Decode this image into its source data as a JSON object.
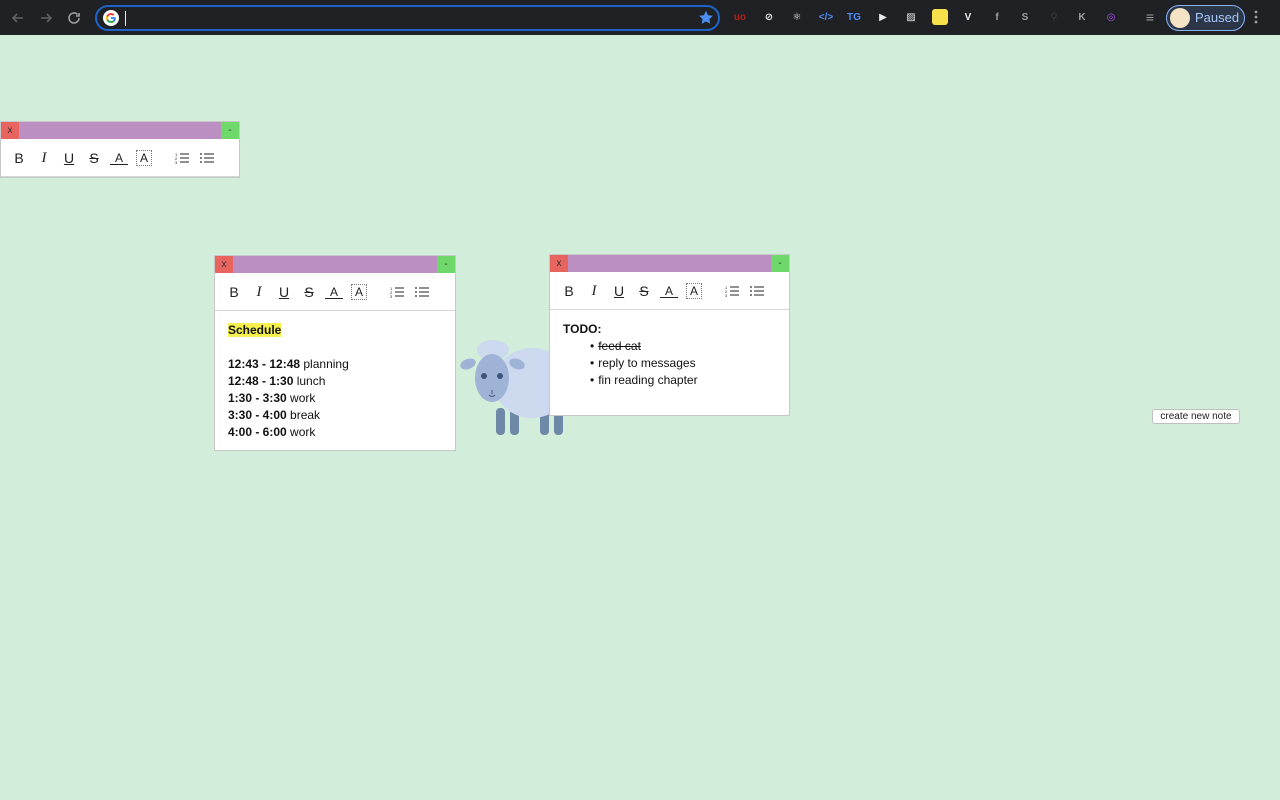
{
  "browser": {
    "omnibox_value": "",
    "profile_label": "Paused",
    "extensions": [
      {
        "name": "ublock-icon",
        "glyph": "uo",
        "color": "#b3201b"
      },
      {
        "name": "privacy-icon",
        "glyph": "⊘",
        "color": "#e8eaed"
      },
      {
        "name": "react-devtools-icon",
        "glyph": "⚛",
        "color": "#e8eaed"
      },
      {
        "name": "code-icon",
        "glyph": "</>",
        "color": "#4a8ef5"
      },
      {
        "name": "calendar-icon",
        "glyph": "TG",
        "color": "#4a8ef5"
      },
      {
        "name": "play-icon",
        "glyph": "▶",
        "color": "#e8eaed"
      },
      {
        "name": "image-icon",
        "glyph": "▨",
        "color": "#e8eaed"
      },
      {
        "name": "sticky-note-icon",
        "glyph": "",
        "color": "#f7e14b"
      },
      {
        "name": "v-icon",
        "glyph": "V",
        "color": "#e8eaed"
      },
      {
        "name": "f-icon",
        "glyph": "f",
        "color": "#9aa0a6"
      },
      {
        "name": "s-icon",
        "glyph": "S",
        "color": "#9aa0a6"
      },
      {
        "name": "key-icon",
        "glyph": "⚲",
        "color": "#3c3c3c"
      },
      {
        "name": "k-icon",
        "glyph": "K",
        "color": "#9aa0a6"
      },
      {
        "name": "target-icon",
        "glyph": "◎",
        "color": "#a855f7"
      }
    ]
  },
  "notes": [
    {
      "close_label": "x",
      "min_label": "-",
      "toolbar": {
        "bold": "B",
        "italic": "I",
        "underline": "U",
        "strike": "S",
        "font_color": "A",
        "highlight": "A"
      }
    },
    {
      "close_label": "x",
      "min_label": "-",
      "toolbar": {
        "bold": "B",
        "italic": "I",
        "underline": "U",
        "strike": "S",
        "font_color": "A",
        "highlight": "A"
      },
      "heading": "Schedule",
      "rows": [
        {
          "time": "12:43 - 12:48",
          "task": " planning"
        },
        {
          "time": "12:48 - 1:30",
          "task": " lunch"
        },
        {
          "time": "1:30 - 3:30",
          "task": " work"
        },
        {
          "time": "3:30 - 4:00",
          "task": " break"
        },
        {
          "time": "4:00 - 6:00",
          "task": " work"
        }
      ]
    },
    {
      "close_label": "x",
      "min_label": "-",
      "toolbar": {
        "bold": "B",
        "italic": "I",
        "underline": "U",
        "strike": "S",
        "font_color": "A",
        "highlight": "A"
      },
      "heading": "TODO:",
      "items": [
        {
          "text": "feed cat",
          "done": true
        },
        {
          "text": "reply to messages",
          "done": false
        },
        {
          "text": "fin reading chapter",
          "done": false
        }
      ]
    }
  ],
  "create_note_label": "create new note",
  "colors": {
    "page_bg": "#d3eddb",
    "note_header": "#bb8fc1",
    "close": "#e8655f",
    "minimize": "#6ed96a",
    "highlight": "#f6f04e"
  }
}
